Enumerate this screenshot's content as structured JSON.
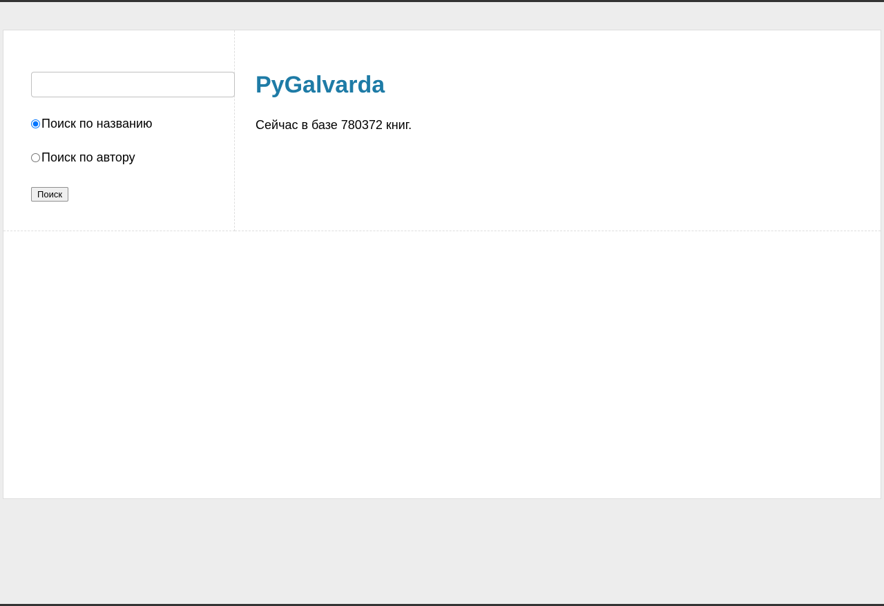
{
  "sidebar": {
    "search": {
      "value": ""
    },
    "radios": {
      "by_title": {
        "label": "Поиск по названию",
        "checked": true
      },
      "by_author": {
        "label": "Поиск по автору",
        "checked": false
      }
    },
    "search_button_label": "Поиск"
  },
  "main": {
    "title": "PyGalvarda",
    "status_text": "Сейчас в базе 780372 книг."
  }
}
